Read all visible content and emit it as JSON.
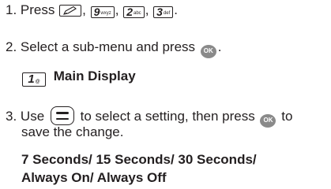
{
  "steps": [
    {
      "number": "1.",
      "text_before": "Press",
      "keys": [
        {
          "label": "",
          "sub": "",
          "icon": "pencil-softkey-icon"
        },
        {
          "label": "9",
          "sub": "wxyz"
        },
        {
          "label": "2",
          "sub": "abc"
        },
        {
          "label": "3",
          "sub": "def"
        }
      ],
      "separators": [
        ",",
        ",",
        ",",
        "."
      ]
    },
    {
      "number": "2.",
      "text": "Select a sub-menu and press",
      "button": "OK",
      "end": "."
    },
    {
      "number": "3.",
      "text_before": "Use",
      "nav_icon": "up-down-navigation-key-icon",
      "text_middle": "to select a setting, then press",
      "button": "OK",
      "text_after": "to",
      "continuation": "save the change."
    }
  ],
  "submenu": {
    "key_label": "1",
    "key_sub": "@",
    "label": "Main Display"
  },
  "options": {
    "line1": "7 Seconds/ 15 Seconds/ 30 Seconds/",
    "line2": "Always On/ Always Off"
  },
  "colors": {
    "text": "#231f20",
    "ok_button": "#8a8a8a"
  }
}
